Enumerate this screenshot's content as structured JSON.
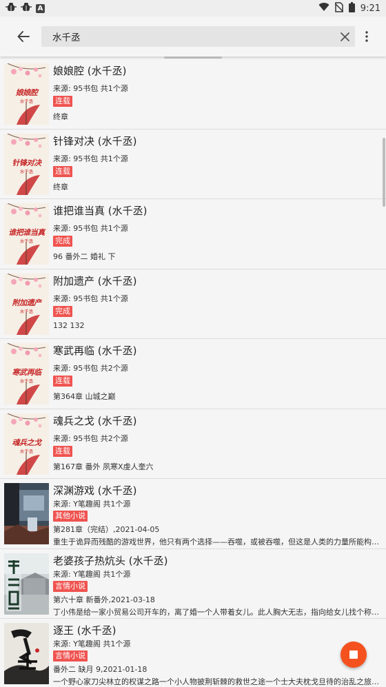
{
  "status_bar": {
    "time": "9:21"
  },
  "search": {
    "query": "水千丞"
  },
  "books": [
    {
      "name": "娘娘腔 (水千丞)",
      "source": "来源: 95书包  共1个源",
      "tag": "连载",
      "latest": "终章",
      "cover_title": "娘娘腔",
      "cover_author": "水千丞"
    },
    {
      "name": "针锋对决 (水千丞)",
      "source": "来源: 95书包  共1个源",
      "tag": "连载",
      "latest": "终章",
      "cover_title": "针锋对决",
      "cover_author": "水千丞"
    },
    {
      "name": "谁把谁当真 (水千丞)",
      "source": "来源: 95书包  共1个源",
      "tag": "完成",
      "latest": "96 番外二 婚礼 下",
      "cover_title": "谁把谁当真",
      "cover_author": "水千丞"
    },
    {
      "name": "附加遗产 (水千丞)",
      "source": "来源: 95书包  共1个源",
      "tag": "完成",
      "latest": "132 132",
      "cover_title": "附加遗产",
      "cover_author": "水千丞"
    },
    {
      "name": "寒武再临 (水千丞)",
      "source": "来源: 95书包  共2个源",
      "tag": "连载",
      "latest": "第364章 山城之巅",
      "cover_title": "寒武再临",
      "cover_author": "水千丞"
    },
    {
      "name": "魂兵之戈 (水千丞)",
      "source": "来源: 95书包  共2个源",
      "tag": "连载",
      "latest": "第167章 番外 夙寒X虔人奎六",
      "cover_title": "魂兵之戈",
      "cover_author": "水千丞"
    },
    {
      "name": "深渊游戏 (水千丞)",
      "source": "来源: Y笔趣阁  共1个源",
      "tag": "其他小说",
      "latest": "第281章（完结）,2021-04-05",
      "intro": "重生于诡异而残酷的游戏世界，他只有两个选择——吞噬，或被吞噬，但这是人类的力量所能构建的最高神殿"
    },
    {
      "name": "老婆孩子热炕头 (水千丞)",
      "source": "来源: Y笔趣阁  共1个源",
      "tag": "言情小说",
      "latest": "第六十章 新番外,2021-03-18",
      "intro": "丁小伟是给一家小贸易公司开车的，离了婚一个人带着女儿。此人胸大无志，指向给女儿找个称心的后妈"
    },
    {
      "name": "逐王 (水千丞)",
      "source": "来源: Y笔趣阁  共1个源",
      "tag": "言情小说",
      "latest": "番外二 缺月 9,2021-01-18",
      "intro": "一个野心家刀尖林立的权谋之路一个小人物披荆斩棘的救世之途一个士大夫枕戈旦待的治乱之旅一个帝王"
    }
  ]
}
